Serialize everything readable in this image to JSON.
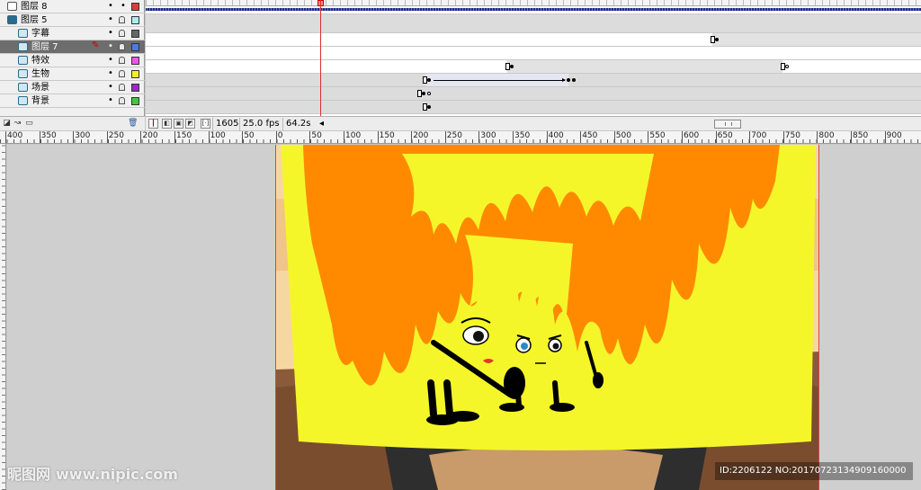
{
  "layers": [
    {
      "name": "图层 8",
      "kind": "audio",
      "color": "#e23a3a",
      "locked": false
    },
    {
      "name": "图层 5",
      "kind": "folder",
      "color": "#a8f0f0",
      "locked": true
    },
    {
      "name": "字幕",
      "kind": "normal",
      "color": "#666666",
      "locked": true
    },
    {
      "name": "图层 7",
      "kind": "normal",
      "color": "#4d78e6",
      "locked": true,
      "selected": true
    },
    {
      "name": "特效",
      "kind": "normal",
      "color": "#ee55ee",
      "locked": true
    },
    {
      "name": "生物",
      "kind": "normal",
      "color": "#f2ef2a",
      "locked": true
    },
    {
      "name": "场景",
      "kind": "normal",
      "color": "#9a2ac8",
      "locked": true
    },
    {
      "name": "背景",
      "kind": "normal",
      "color": "#3acb3a",
      "locked": true
    }
  ],
  "timeline": {
    "current_frame": "1605",
    "fps": "25.0 fps",
    "elapsed": "64.2s"
  },
  "ruler": {
    "labels": [
      "400",
      "350",
      "300",
      "250",
      "200",
      "150",
      "100",
      "50",
      "0",
      "50",
      "100",
      "150",
      "200",
      "250",
      "300",
      "350",
      "400",
      "450",
      "500",
      "550",
      "600",
      "650",
      "700",
      "750",
      "800",
      "850",
      "900"
    ]
  },
  "watermark": {
    "brand": "昵图网",
    "site": "www.nipic.com",
    "id_text": "ID:2206122 NO:20170723134909160000"
  },
  "colors": {
    "fire_outer": "#f4f62a",
    "fire_inner": "#ff8a00",
    "ground": "#8a5a3a",
    "selection": "#6d6d6d"
  }
}
